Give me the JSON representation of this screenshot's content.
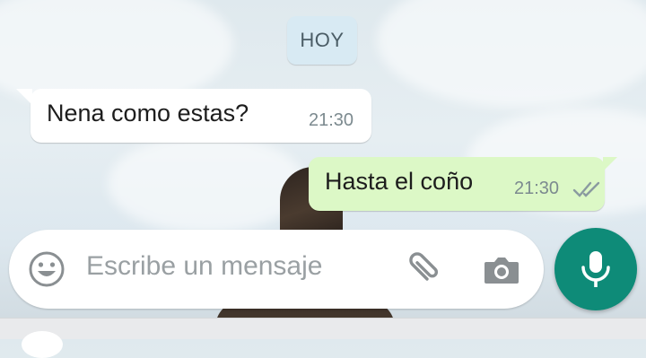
{
  "date_separator": "HOY",
  "messages": [
    {
      "direction": "incoming",
      "text": "Nena como estas?",
      "time": "21:30"
    },
    {
      "direction": "outgoing",
      "text": "Hasta el coño",
      "time": "21:30",
      "status": "delivered"
    }
  ],
  "composer": {
    "placeholder": "Escribe un mensaje",
    "emoji_icon": "emoji-icon",
    "attach_icon": "paperclip-icon",
    "camera_icon": "camera-icon",
    "mic_icon": "microphone-icon"
  },
  "colors": {
    "outgoing_bubble": "#dcf8c6",
    "incoming_bubble": "#ffffff",
    "accent": "#0e8b78",
    "date_chip": "#d8eaf3"
  }
}
